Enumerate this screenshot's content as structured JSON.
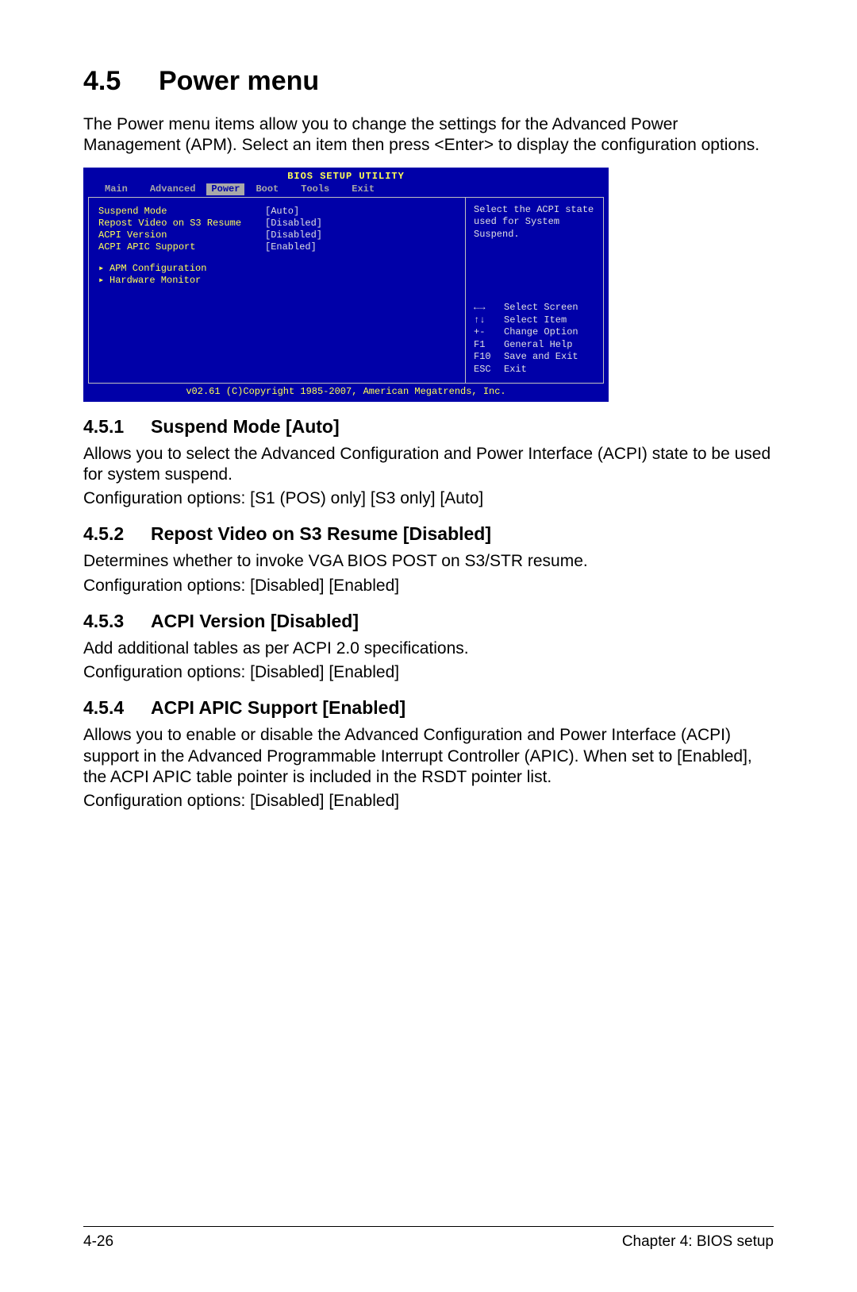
{
  "section": {
    "number": "4.5",
    "title": "Power menu",
    "intro": "The Power menu items allow you to change the settings for the Advanced Power Management (APM). Select an item then press <Enter> to display the configuration options."
  },
  "bios": {
    "title": "BIOS SETUP UTILITY",
    "tabs": [
      "Main",
      "Advanced",
      "Power",
      "Boot",
      "Tools",
      "Exit"
    ],
    "active_tab_index": 2,
    "items": [
      {
        "label": "Suspend Mode",
        "value": "[Auto]"
      },
      {
        "label": "Repost Video on S3 Resume",
        "value": "[Disabled]"
      },
      {
        "label": "ACPI Version",
        "value": "[Disabled]"
      },
      {
        "label": "ACPI APIC Support",
        "value": "[Enabled]"
      }
    ],
    "submenus": [
      "APM Configuration",
      "Hardware Monitor"
    ],
    "help_text": "Select the ACPI state used for System Suspend.",
    "keys": [
      {
        "key": "←→",
        "desc": "Select Screen"
      },
      {
        "key": "↑↓",
        "desc": "Select Item"
      },
      {
        "key": "+-",
        "desc": "Change Option"
      },
      {
        "key": "F1",
        "desc": "General Help"
      },
      {
        "key": "F10",
        "desc": "Save and Exit"
      },
      {
        "key": "ESC",
        "desc": "Exit"
      }
    ],
    "footer": "v02.61 (C)Copyright 1985-2007, American Megatrends, Inc."
  },
  "subsections": [
    {
      "number": "4.5.1",
      "title": "Suspend Mode [Auto]",
      "body": "Allows you to select the Advanced Configuration and Power Interface (ACPI) state to be used for system suspend.",
      "config": "Configuration options: [S1 (POS) only] [S3 only] [Auto]"
    },
    {
      "number": "4.5.2",
      "title": "Repost Video on S3 Resume [Disabled]",
      "body": "Determines whether to invoke VGA BIOS POST on S3/STR resume.",
      "config": "Configuration options: [Disabled] [Enabled]"
    },
    {
      "number": "4.5.3",
      "title": "ACPI Version [Disabled]",
      "body": "Add additional tables as per ACPI 2.0 specifications.",
      "config": "Configuration options: [Disabled] [Enabled]"
    },
    {
      "number": "4.5.4",
      "title": "ACPI APIC Support [Enabled]",
      "body": "Allows you to enable or disable the Advanced Configuration and Power Interface (ACPI) support in the Advanced Programmable Interrupt Controller (APIC). When set to [Enabled], the ACPI APIC table pointer is included in the RSDT pointer list.",
      "config": "Configuration options: [Disabled] [Enabled]"
    }
  ],
  "footer": {
    "left": "4-26",
    "right": "Chapter 4: BIOS setup"
  }
}
